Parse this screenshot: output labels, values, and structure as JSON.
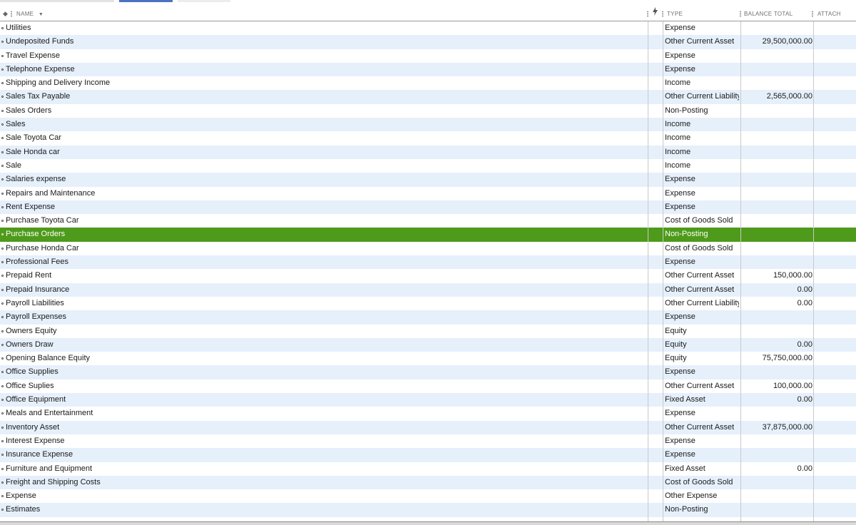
{
  "header": {
    "sort_icon": "diamond-sort-icon",
    "name_label": "NAME",
    "activity_icon": "lightning-icon",
    "type_label": "TYPE",
    "balance_label": "BALANCE TOTAL",
    "attach_label": "ATTACH"
  },
  "colors": {
    "selected_row": "#4e9a1a",
    "alt_row": "#e6f0fb",
    "accent": "#4a73c2"
  },
  "accounts": [
    {
      "name": "Utilities",
      "type": "Expense",
      "balance": ""
    },
    {
      "name": "Undeposited Funds",
      "type": "Other Current Asset",
      "balance": "29,500,000.00"
    },
    {
      "name": "Travel Expense",
      "type": "Expense",
      "balance": ""
    },
    {
      "name": "Telephone Expense",
      "type": "Expense",
      "balance": ""
    },
    {
      "name": "Shipping and Delivery Income",
      "type": "Income",
      "balance": ""
    },
    {
      "name": "Sales Tax Payable",
      "type": "Other Current Liability",
      "balance": "2,565,000.00"
    },
    {
      "name": "Sales Orders",
      "type": "Non-Posting",
      "balance": ""
    },
    {
      "name": "Sales",
      "type": "Income",
      "balance": ""
    },
    {
      "name": "Sale Toyota Car",
      "type": "Income",
      "balance": ""
    },
    {
      "name": "Sale Honda car",
      "type": "Income",
      "balance": ""
    },
    {
      "name": "Sale",
      "type": "Income",
      "balance": ""
    },
    {
      "name": "Salaries expense",
      "type": "Expense",
      "balance": ""
    },
    {
      "name": "Repairs and Maintenance",
      "type": "Expense",
      "balance": ""
    },
    {
      "name": "Rent Expense",
      "type": "Expense",
      "balance": ""
    },
    {
      "name": "Purchase Toyota Car",
      "type": "Cost of Goods Sold",
      "balance": ""
    },
    {
      "name": "Purchase Orders",
      "type": "Non-Posting",
      "balance": "",
      "selected": true
    },
    {
      "name": "Purchase Honda Car",
      "type": "Cost of Goods Sold",
      "balance": ""
    },
    {
      "name": "Professional Fees",
      "type": "Expense",
      "balance": ""
    },
    {
      "name": "Prepaid Rent",
      "type": "Other Current Asset",
      "balance": "150,000.00"
    },
    {
      "name": "Prepaid Insurance",
      "type": "Other Current Asset",
      "balance": "0.00"
    },
    {
      "name": "Payroll Liabilities",
      "type": "Other Current Liability",
      "balance": "0.00"
    },
    {
      "name": "Payroll Expenses",
      "type": "Expense",
      "balance": ""
    },
    {
      "name": "Owners Equity",
      "type": "Equity",
      "balance": ""
    },
    {
      "name": "Owners Draw",
      "type": "Equity",
      "balance": "0.00"
    },
    {
      "name": "Opening Balance Equity",
      "type": "Equity",
      "balance": "75,750,000.00"
    },
    {
      "name": "Office Supplies",
      "type": "Expense",
      "balance": ""
    },
    {
      "name": "Office Suplies",
      "type": "Other Current Asset",
      "balance": "100,000.00"
    },
    {
      "name": "Office Equipment",
      "type": "Fixed Asset",
      "balance": "0.00"
    },
    {
      "name": "Meals and Entertainment",
      "type": "Expense",
      "balance": ""
    },
    {
      "name": "Inventory Asset",
      "type": "Other Current Asset",
      "balance": "37,875,000.00"
    },
    {
      "name": "Interest Expense",
      "type": "Expense",
      "balance": ""
    },
    {
      "name": "Insurance Expense",
      "type": "Expense",
      "balance": ""
    },
    {
      "name": "Furniture and Equipment",
      "type": "Fixed Asset",
      "balance": "0.00"
    },
    {
      "name": "Freight and Shipping Costs",
      "type": "Cost of Goods Sold",
      "balance": ""
    },
    {
      "name": "Expense",
      "type": "Other Expense",
      "balance": ""
    },
    {
      "name": "Estimates",
      "type": "Non-Posting",
      "balance": ""
    }
  ]
}
